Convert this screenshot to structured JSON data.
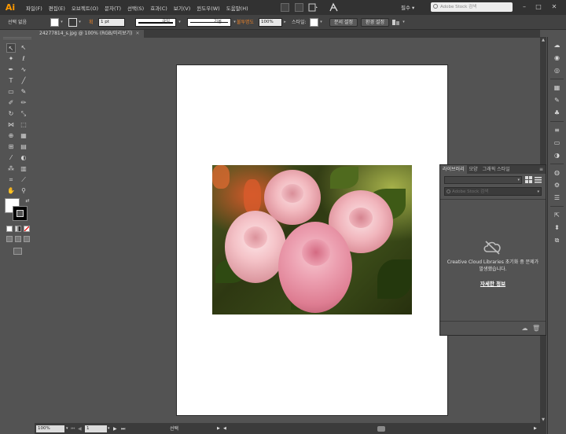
{
  "app": {
    "logo": "Ai",
    "accent": "#FF9A00"
  },
  "menu": {
    "items": [
      "파일(F)",
      "편집(E)",
      "오브젝트(O)",
      "문자(T)",
      "선택(S)",
      "효과(C)",
      "보기(V)",
      "윈도우(W)",
      "도움말(H)"
    ],
    "workspace": "필수",
    "stock_placeholder": "Adobe Stock 검색"
  },
  "controlbar": {
    "selection_label": "선택 없음",
    "stroke_label": "획",
    "stroke_weight": "1 pt",
    "stroke_profile_label": "균일",
    "brush_label": "기본",
    "opacity_label": "불투명도",
    "opacity_value": "100%",
    "style_label": "스타일:",
    "doc_setup_button": "문서 설정",
    "prefs_button": "환경 설정"
  },
  "document": {
    "tab_title": "24277814_s.jpg @ 100% (RGB/미리보기)",
    "close_glyph": "✕"
  },
  "statusbar": {
    "zoom": "100%",
    "artboard_num": "1",
    "tool_status": "선택"
  },
  "libraries_panel": {
    "tabs": [
      "라이브러리",
      "모양",
      "그래픽 스타일"
    ],
    "search_placeholder": "Adobe Stock 검색",
    "error_message": "Creative Cloud Libraries 초기화 중 문제가 발생했습니다.",
    "more_info_link": "자세한 정보"
  },
  "icons": {
    "toolbox": [
      "selection-tool-icon",
      "direct-selection-tool-icon",
      "magic-wand-icon",
      "lasso-icon",
      "pen-tool-icon",
      "curvature-tool-icon",
      "type-tool-icon",
      "line-tool-icon",
      "rectangle-tool-icon",
      "paintbrush-icon",
      "shaper-tool-icon",
      "pencil-icon",
      "rotate-tool-icon",
      "scale-tool-icon",
      "width-tool-icon",
      "free-transform-icon",
      "shape-builder-icon",
      "perspective-grid-icon",
      "mesh-tool-icon",
      "gradient-tool-icon",
      "eyedropper-icon",
      "blend-tool-icon",
      "symbol-sprayer-icon",
      "column-graph-icon",
      "artboard-tool-icon",
      "slice-tool-icon",
      "hand-tool-icon",
      "zoom-tool-icon"
    ],
    "dock": [
      "libraries-icon",
      "color-icon",
      "color-guide-icon",
      "swatches-icon",
      "brushes-icon",
      "symbols-icon",
      "stroke-icon",
      "gradient-icon",
      "transparency-icon",
      "appearance-icon",
      "graphic-styles-icon",
      "layers-icon",
      "artboards-icon",
      "align-icon",
      "pathfinder-icon",
      "transform-icon"
    ]
  }
}
